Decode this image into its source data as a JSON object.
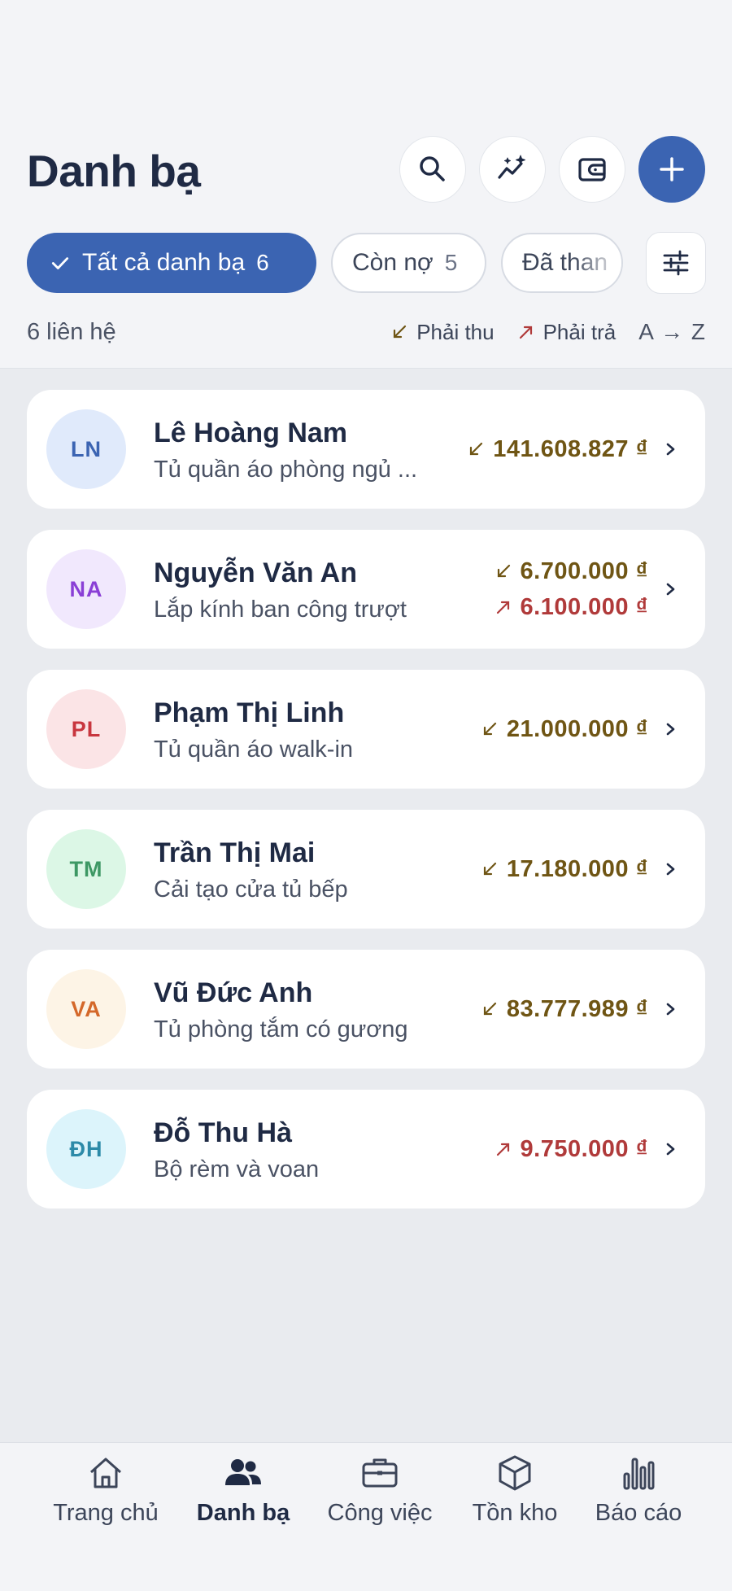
{
  "header": {
    "title": "Danh bạ",
    "icons": [
      "search-icon",
      "analytics-icon",
      "wallet-icon",
      "plus-icon"
    ]
  },
  "filters": {
    "all": {
      "label": "Tất cả danh bạ",
      "count": "6"
    },
    "debt": {
      "label": "Còn nợ",
      "count": "5"
    },
    "paid": {
      "label": "Đã than"
    }
  },
  "summary": {
    "count_text": "6 liên hệ",
    "legend_receivable": "Phải thu",
    "legend_payable": "Phải trả",
    "sort": "A → Z"
  },
  "contacts": [
    {
      "initials": "LN",
      "name": "Lê Hoàng Nam",
      "desc": "Tủ quần áo phòng ngủ ...",
      "receivable": "141.608.827 ₫",
      "payable": null,
      "avatar_bg": "#e0eafb",
      "avatar_fg": "#3b64b2"
    },
    {
      "initials": "NA",
      "name": "Nguyễn Văn An",
      "desc": "Lắp kính ban công trượt",
      "receivable": "6.700.000 ₫",
      "payable": "6.100.000 ₫",
      "avatar_bg": "#f1e8fd",
      "avatar_fg": "#8a3fd6"
    },
    {
      "initials": "PL",
      "name": "Phạm Thị Linh",
      "desc": "Tủ quần áo walk-in",
      "receivable": "21.000.000 ₫",
      "payable": null,
      "avatar_bg": "#fbe4e6",
      "avatar_fg": "#c8363f"
    },
    {
      "initials": "TM",
      "name": "Trần Thị Mai",
      "desc": "Cải tạo cửa tủ bếp",
      "receivable": "17.180.000 ₫",
      "payable": null,
      "avatar_bg": "#dcf7e6",
      "avatar_fg": "#3d9864"
    },
    {
      "initials": "VA",
      "name": "Vũ Đức Anh",
      "desc": "Tủ phòng tắm có gương",
      "receivable": "83.777.989 ₫",
      "payable": null,
      "avatar_bg": "#fdf4e6",
      "avatar_fg": "#d4682a"
    },
    {
      "initials": "ĐH",
      "name": "Đỗ Thu Hà",
      "desc": "Bộ rèm và voan",
      "receivable": null,
      "payable": "9.750.000 ₫",
      "avatar_bg": "#dcf4fb",
      "avatar_fg": "#2c8aa8"
    }
  ],
  "tabs": [
    {
      "label": "Trang chủ",
      "icon": "home-icon"
    },
    {
      "label": "Danh bạ",
      "icon": "contacts-icon"
    },
    {
      "label": "Công việc",
      "icon": "briefcase-icon"
    },
    {
      "label": "Tồn kho",
      "icon": "box-icon"
    },
    {
      "label": "Báo cáo",
      "icon": "bar-chart-icon"
    }
  ],
  "colors": {
    "accent": "#3b64b2",
    "receivable": "#6f5514",
    "payable": "#b03a3a"
  }
}
